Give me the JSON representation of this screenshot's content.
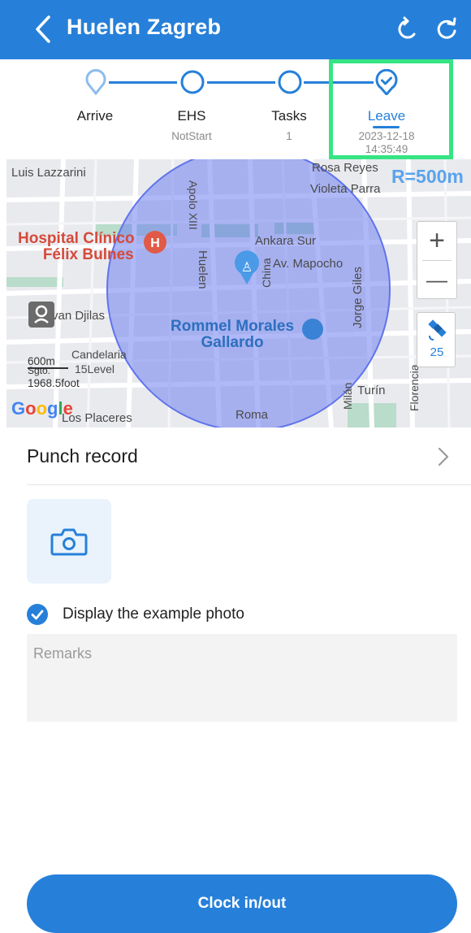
{
  "header": {
    "title": "Huelen  Zagreb",
    "back_icon": "chevron-left-icon",
    "refresh_icons": [
      "refresh-ccw-icon",
      "refresh-cw-icon"
    ]
  },
  "stepper": {
    "steps": [
      {
        "label": "Arrive",
        "sub": "",
        "state": "pending"
      },
      {
        "label": "EHS",
        "sub": "NotStart",
        "state": "pending"
      },
      {
        "label": "Tasks",
        "sub": "1",
        "state": "pending"
      },
      {
        "label": "Leave",
        "sub": "2023-12-18",
        "sub2": "14:35:49",
        "state": "active"
      }
    ]
  },
  "map": {
    "radius_label": "R=500m",
    "places": {
      "luis": "Luis Lazzarini",
      "rosa": "Rosa Reyes",
      "violeta": "Violeta Parra",
      "apolo": "Apolo XIII",
      "hospital_line1": "Hospital Clínico",
      "hospital_line2": "Félix Bulnes",
      "ankara": "Ankara Sur",
      "mapocho": "Av. Mapocho",
      "huelen": "Huelen",
      "china": "China",
      "jorge": "Jorge Giles",
      "ivan": "van Djilas",
      "rommel_line1": "Rommel Morales",
      "rommel_line2": "Gallardo",
      "candelaria": "Candelaria",
      "sgto": "Sgto.",
      "level": "15Level",
      "milan": "Milán",
      "turin": "Turín",
      "florencia": "Florencia",
      "roma": "Roma",
      "placeres": "Los Placeres"
    },
    "scale_m": "600m",
    "scale_ft": "1968.5foot",
    "zoom_in": "+",
    "zoom_out": "—",
    "satellite_count": "25",
    "google": "Google",
    "accent": "#2680d9"
  },
  "punch": {
    "label": "Punch record"
  },
  "photo": {
    "icon": "camera-icon"
  },
  "example_photo": {
    "label": "Display the example photo",
    "checked": true
  },
  "remarks": {
    "placeholder": "Remarks",
    "value": ""
  },
  "clock_button": {
    "label": "Clock in/out"
  }
}
